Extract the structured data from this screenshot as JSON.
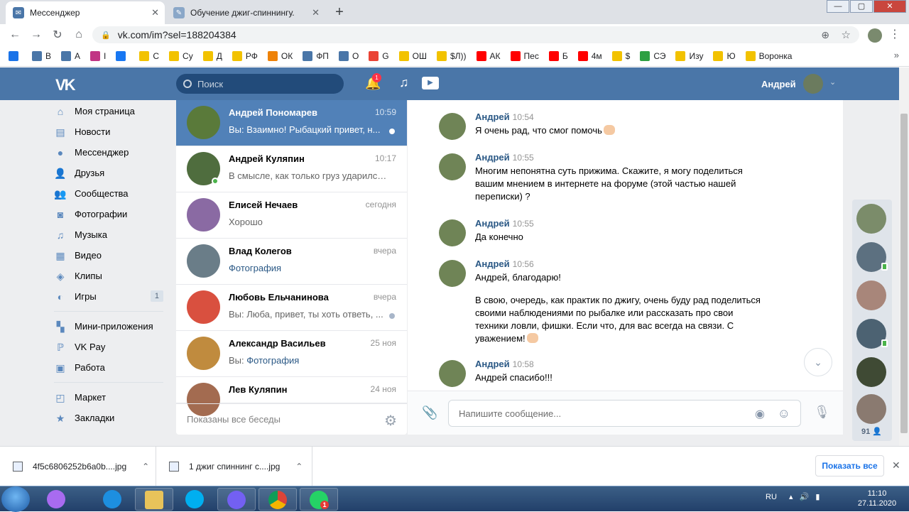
{
  "browser": {
    "tabs": [
      {
        "title": "Мессенджер",
        "active": true
      },
      {
        "title": "Обучение джиг-спиннингу. Ма",
        "active": false
      }
    ],
    "url": "vk.com/im?sel=188204384",
    "bookmarks": [
      {
        "label": "",
        "color": "#1a73e8"
      },
      {
        "label": "В",
        "color": "#4a76a8"
      },
      {
        "label": "А",
        "color": "#4a76a8"
      },
      {
        "label": "I",
        "color": "#c13584"
      },
      {
        "label": "",
        "color": "#1877f2"
      },
      {
        "label": "С",
        "color": "#f2c200"
      },
      {
        "label": "Су",
        "color": "#f2c200"
      },
      {
        "label": "Д",
        "color": "#f2c200"
      },
      {
        "label": "РФ",
        "color": "#f2c200"
      },
      {
        "label": "ОК",
        "color": "#ee8208"
      },
      {
        "label": "ФП",
        "color": "#4a76a8"
      },
      {
        "label": "О",
        "color": "#4a76a8"
      },
      {
        "label": "G",
        "color": "#ea4335"
      },
      {
        "label": "ОШ",
        "color": "#f2c200"
      },
      {
        "label": "$Л))",
        "color": "#f2c200"
      },
      {
        "label": "АК",
        "color": "#ff0000"
      },
      {
        "label": "Пес",
        "color": "#ff0000"
      },
      {
        "label": "Б",
        "color": "#ff0000"
      },
      {
        "label": "4м",
        "color": "#ff0000"
      },
      {
        "label": "$",
        "color": "#f2c200"
      },
      {
        "label": "СЭ",
        "color": "#2ea043"
      },
      {
        "label": "Изу",
        "color": "#f2c200"
      },
      {
        "label": "Ю",
        "color": "#f2c200"
      },
      {
        "label": "Воронка",
        "color": "#f2c200"
      }
    ]
  },
  "vk": {
    "search_placeholder": "Поиск",
    "notif_count": "1",
    "user_name": "Андрей",
    "nav": [
      {
        "label": "Моя страница",
        "icon": "home-icon",
        "glyph": "⌂"
      },
      {
        "label": "Новости",
        "icon": "news-icon",
        "glyph": "▤"
      },
      {
        "label": "Мессенджер",
        "icon": "messenger-icon",
        "glyph": "●"
      },
      {
        "label": "Друзья",
        "icon": "friends-icon",
        "glyph": "👤"
      },
      {
        "label": "Сообщества",
        "icon": "communities-icon",
        "glyph": "👥"
      },
      {
        "label": "Фотографии",
        "icon": "camera-icon",
        "glyph": "◙"
      },
      {
        "label": "Музыка",
        "icon": "music-icon",
        "glyph": "♫"
      },
      {
        "label": "Видео",
        "icon": "video-icon",
        "glyph": "▦"
      },
      {
        "label": "Клипы",
        "icon": "clips-icon",
        "glyph": "◈"
      },
      {
        "label": "Игры",
        "icon": "games-icon",
        "glyph": "◐",
        "count": "1"
      }
    ],
    "nav2": [
      {
        "label": "Мини-приложения",
        "icon": "apps-icon",
        "glyph": "▚"
      },
      {
        "label": "VK Pay",
        "icon": "vkpay-icon",
        "glyph": "ℙ"
      },
      {
        "label": "Работа",
        "icon": "work-icon",
        "glyph": "▣"
      }
    ],
    "nav3": [
      {
        "label": "Маркет",
        "icon": "market-icon",
        "glyph": "◰"
      },
      {
        "label": "Закладки",
        "icon": "bookmark-icon",
        "glyph": "★"
      }
    ],
    "conversations": [
      {
        "name": "Андрей Пономарев",
        "time": "10:59",
        "prefix": "Вы: ",
        "text": "Взаимно! Рыбацкий привет, н...",
        "selected": true,
        "dot": true,
        "color": "#5a7a3a"
      },
      {
        "name": "Андрей Куляпин",
        "time": "10:17",
        "prefix": "",
        "text": "В смысле, как только груз ударился ...",
        "selected": false,
        "online": true,
        "color": "#4f6d3e"
      },
      {
        "name": "Елисей Нечаев",
        "time": "сегодня",
        "prefix": "",
        "text": "Хорошо",
        "selected": false,
        "color": "#8a6aa3"
      },
      {
        "name": "Влад Колегов",
        "time": "вчера",
        "prefix": "",
        "text": "Фотография",
        "link": true,
        "selected": false,
        "color": "#6a7d88"
      },
      {
        "name": "Любовь Ельчанинова",
        "time": "вчера",
        "prefix": "Вы: ",
        "text": "Люба, привет, ты хоть ответь, ...",
        "selected": false,
        "dot": true,
        "color": "#d9503f"
      },
      {
        "name": "Александр Васильев",
        "time": "25 ноя",
        "prefix": "Вы: ",
        "text": "Фотография",
        "link": true,
        "selected": false,
        "color": "#c08b3e"
      },
      {
        "name": "Лев Куляпин",
        "time": "24 ноя",
        "prefix": "",
        "text": "",
        "selected": false,
        "color": "#a36b50"
      }
    ],
    "conv_footer": "Показаны все беседы",
    "messages": [
      {
        "author": "Андрей",
        "time": "10:54",
        "lines": [
          "Я очень рад, что смог помочь"
        ],
        "emoji": true
      },
      {
        "author": "Андрей",
        "time": "10:55",
        "lines": [
          "Многим непонятна суть прижима. Скажите, я могу поделиться",
          "вашим мнением в интернете на форуме (этой частью нашей",
          "переписки) ?"
        ]
      },
      {
        "author": "Андрей",
        "time": "10:55",
        "lines": [
          "Да конечно"
        ]
      },
      {
        "author": "Андрей",
        "time": "10:56",
        "lines": [
          "Андрей, благодарю!",
          "",
          "В свою, очередь, как практик по джигу, очень буду рад поделиться",
          "своими наблюдениями по рыбалке или рассказать про свои",
          "техники ловли, фишки. Если что, для вас всегда на связи. С",
          "уважением!"
        ],
        "emoji": true
      },
      {
        "author": "Андрей",
        "time": "10:58",
        "lines": [
          "Андрей спасибо!!!"
        ]
      }
    ],
    "message_placeholder": "Напишите сообщение...",
    "online_count": "91"
  },
  "downloads": {
    "items": [
      "4f5c6806252b6a0b....jpg",
      "1 джиг спиннинг с....jpg"
    ],
    "show_all": "Показать все"
  },
  "taskbar": {
    "lang": "RU",
    "time": "11:10",
    "date": "27.11.2020",
    "whatsapp_badge": "1"
  }
}
